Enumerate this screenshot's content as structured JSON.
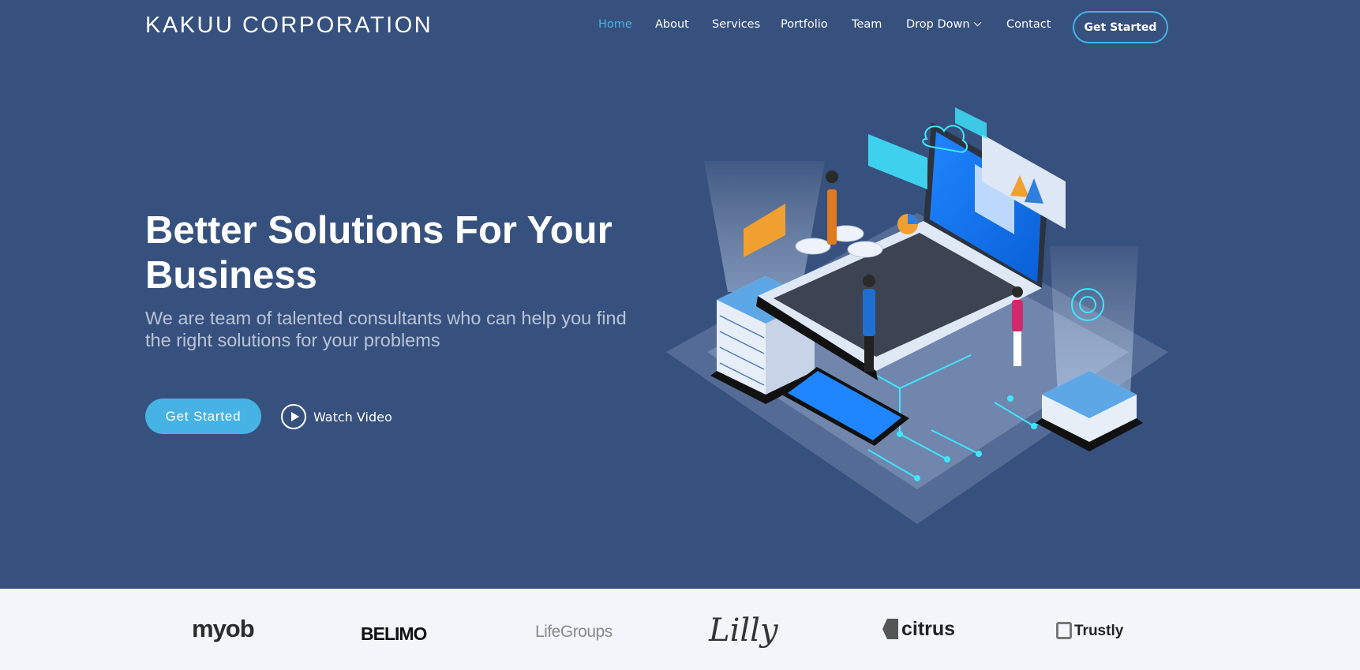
{
  "header": {
    "logo": "KAKUU CORPORATION",
    "nav": [
      {
        "label": "Home",
        "active": true
      },
      {
        "label": "About"
      },
      {
        "label": "Services"
      },
      {
        "label": "Portfolio"
      },
      {
        "label": "Team"
      },
      {
        "label": "Drop Down",
        "dropdown": true
      },
      {
        "label": "Contact"
      }
    ],
    "cta": "Get Started"
  },
  "hero": {
    "title": "Better Solutions For Your Business",
    "subtitle": "We are team of talented consultants who can help you find the right solutions for your problems",
    "primary_button": "Get Started",
    "video_button": "Watch Video",
    "illustration": "isometric-laptop-servers-illustration"
  },
  "clients": [
    {
      "name": "myob"
    },
    {
      "name": "BELIMO"
    },
    {
      "name": "LifeGroups"
    },
    {
      "name": "Lilly"
    },
    {
      "name": "citrus"
    },
    {
      "name": "Trustly"
    }
  ],
  "colors": {
    "hero_bg": "#37517e",
    "accent": "#47b2e4",
    "clients_bg": "#f3f5fa"
  }
}
